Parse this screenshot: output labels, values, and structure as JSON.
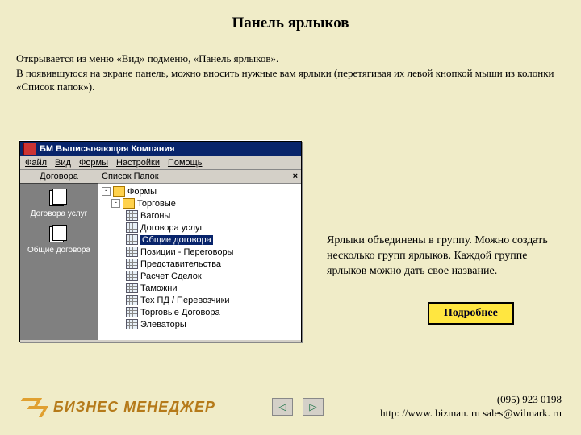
{
  "title": "Панель ярлыков",
  "intro": "Открывается из меню «Вид» подменю, «Панель ярлыков».\nВ появившуюся на экране панель, можно вносить нужные вам ярлыки (перетягивая их левой кнопкой мыши из колонки «Список папок»).",
  "caption": "Ярлыки объединены в группу. Можно создать несколько групп ярлыков. Каждой группе ярлыков можно дать свое название.",
  "more": "Подробнее",
  "win": {
    "title": "БМ Выписывающая Компания",
    "menu": [
      "Файл",
      "Вид",
      "Формы",
      "Настройки",
      "Помощь"
    ],
    "shortcut_header": "Договора",
    "shortcuts": [
      "Договора услуг",
      "Общие договора"
    ],
    "tree_header": "Список Папок",
    "close": "×",
    "root": {
      "toggle": "-",
      "label": "Формы"
    },
    "branch": {
      "toggle": "-",
      "label": "Торговые"
    },
    "leaves": [
      "Вагоны",
      "Договора услуг",
      "Общие договора",
      "Позиции - Переговоры",
      "Представительства",
      "Расчет Сделок",
      "Таможни",
      "Тех ПД / Перевозчики",
      "Торговые Договора",
      "Элеваторы"
    ],
    "selected_index": 2
  },
  "logo": "БИЗНЕС МЕНЕДЖЕР",
  "contact": {
    "phone": "(095) 923 0198",
    "line2": "http: //www. bizman. ru   sales@wilmark. ru"
  }
}
